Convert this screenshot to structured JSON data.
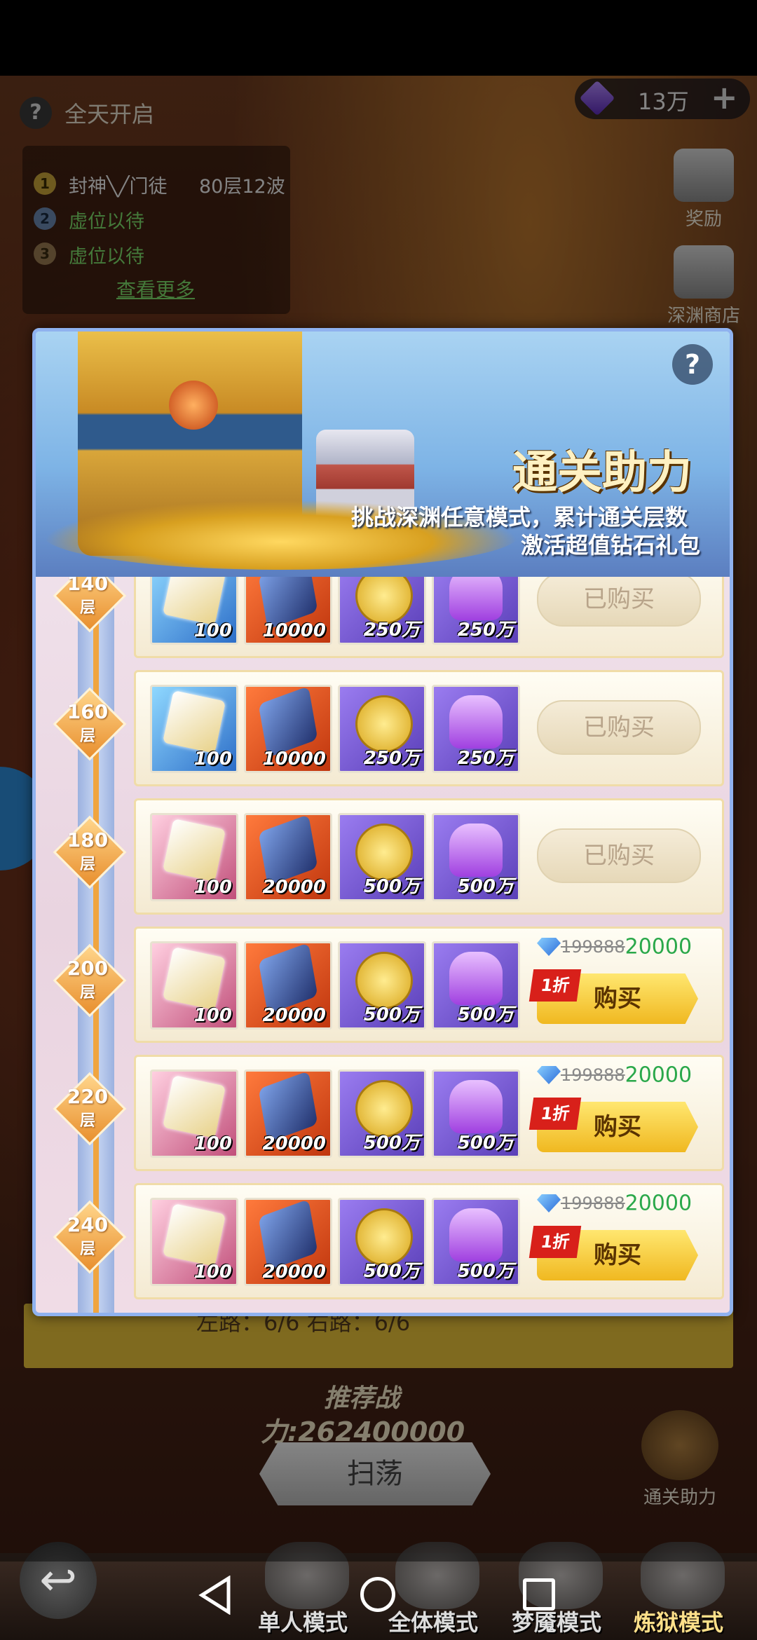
{
  "hud": {
    "help_glyph": "?",
    "open_status": "全天开启",
    "diamond_count": "13万",
    "plus": "+"
  },
  "ranking": [
    {
      "rank": "1",
      "name": "封神╲╱门徒",
      "score": "80层12波"
    },
    {
      "rank": "2",
      "name": "虚位以待",
      "score": ""
    },
    {
      "rank": "3",
      "name": "虚位以待",
      "score": ""
    }
  ],
  "view_more": "查看更多",
  "side_buttons": {
    "reward": "奖励",
    "abyss_shop": "深渊商店",
    "clear_assist": "通关助力"
  },
  "modal": {
    "help_glyph": "?",
    "title": "通关助力",
    "subtitle_line1": "挑战深渊任意模式，累计通关层数",
    "subtitle_line2": "激活超值钻石礼包"
  },
  "tiers": [
    {
      "floor": "140",
      "unit": "层",
      "items": [
        {
          "icon": "blue-cube-icon",
          "qty": "100"
        },
        {
          "icon": "crystal-icon",
          "qty": "10000"
        },
        {
          "icon": "gold-coin-icon",
          "qty": "250万"
        },
        {
          "icon": "potion-icon",
          "qty": "250万"
        }
      ],
      "status": "bought",
      "bought_label": "已购买"
    },
    {
      "floor": "160",
      "unit": "层",
      "items": [
        {
          "icon": "blue-cube-icon",
          "qty": "100"
        },
        {
          "icon": "crystal-icon",
          "qty": "10000"
        },
        {
          "icon": "gold-coin-icon",
          "qty": "250万"
        },
        {
          "icon": "potion-icon",
          "qty": "250万"
        }
      ],
      "status": "bought",
      "bought_label": "已购买"
    },
    {
      "floor": "180",
      "unit": "层",
      "items": [
        {
          "icon": "pink-cube-icon",
          "qty": "100"
        },
        {
          "icon": "crystal-icon",
          "qty": "20000"
        },
        {
          "icon": "gold-coin-icon",
          "qty": "500万"
        },
        {
          "icon": "potion-icon",
          "qty": "500万"
        }
      ],
      "status": "bought",
      "bought_label": "已购买"
    },
    {
      "floor": "200",
      "unit": "层",
      "items": [
        {
          "icon": "pink-cube-icon",
          "qty": "100"
        },
        {
          "icon": "crystal-icon",
          "qty": "20000"
        },
        {
          "icon": "gold-coin-icon",
          "qty": "500万"
        },
        {
          "icon": "potion-icon",
          "qty": "500万"
        }
      ],
      "status": "buy",
      "old_price": "199888",
      "new_price": "20000",
      "discount": "1折",
      "buy_label": "购买"
    },
    {
      "floor": "220",
      "unit": "层",
      "items": [
        {
          "icon": "pink-cube-icon",
          "qty": "100"
        },
        {
          "icon": "crystal-icon",
          "qty": "20000"
        },
        {
          "icon": "gold-coin-icon",
          "qty": "500万"
        },
        {
          "icon": "potion-icon",
          "qty": "500万"
        }
      ],
      "status": "buy",
      "old_price": "199888",
      "new_price": "20000",
      "discount": "1折",
      "buy_label": "购买"
    },
    {
      "floor": "240",
      "unit": "层",
      "items": [
        {
          "icon": "pink-cube-icon",
          "qty": "100"
        },
        {
          "icon": "crystal-icon",
          "qty": "20000"
        },
        {
          "icon": "gold-coin-icon",
          "qty": "500万"
        },
        {
          "icon": "potion-icon",
          "qty": "500万"
        }
      ],
      "status": "buy",
      "old_price": "199888",
      "new_price": "20000",
      "discount": "1折",
      "buy_label": "购买"
    }
  ],
  "path_status": "左路：6/6    右路：6/6",
  "recommend": {
    "label": "推荐战",
    "power": "力:262400000"
  },
  "sweep_label": "扫荡",
  "modes": {
    "single": "单人模式",
    "all": "全体模式",
    "nightmare": "梦魇模式",
    "hell": "炼狱模式"
  },
  "back_glyph": "↩",
  "colors": {
    "modal_border": "#8fb2ef",
    "price_new": "#2aa84a",
    "buy_button": "#f0b820",
    "discount_tag": "#d8201a",
    "floor_marker": "#e88f2e"
  }
}
